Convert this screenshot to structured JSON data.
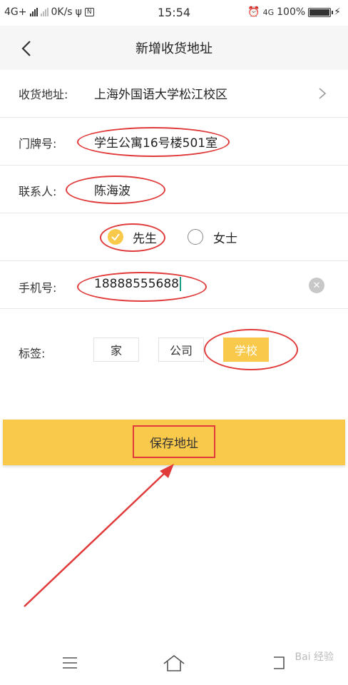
{
  "status_bar": {
    "network": "4G+",
    "speed": "0K/s",
    "time": "15:54",
    "network2": "4G",
    "battery": "100%",
    "battery_fraction": 1.0
  },
  "header": {
    "title": "新增收货地址"
  },
  "form": {
    "address": {
      "label": "收货地址:",
      "value": "上海外国语大学松江校区"
    },
    "doorplate": {
      "label": "门牌号:",
      "value": "学生公寓16号楼501室"
    },
    "contact": {
      "label": "联系人:",
      "value": "陈海波"
    },
    "gender": {
      "options": [
        {
          "label": "先生",
          "selected": true
        },
        {
          "label": "女士",
          "selected": false
        }
      ]
    },
    "phone": {
      "label": "手机号:",
      "value": "18888555688"
    },
    "tags": {
      "label": "标签:",
      "options": [
        {
          "label": "家",
          "selected": false
        },
        {
          "label": "公司",
          "selected": false
        },
        {
          "label": "学校",
          "selected": true
        }
      ]
    }
  },
  "save_button": {
    "label": "保存地址"
  },
  "colors": {
    "accent": "#f8c94a",
    "annotation": "#e03a3a"
  },
  "icons": [
    "back-icon",
    "chevron-right-icon",
    "check-icon",
    "clear-icon",
    "menu-icon",
    "home-icon",
    "back-nav-icon"
  ],
  "watermark": "Bai 经验"
}
